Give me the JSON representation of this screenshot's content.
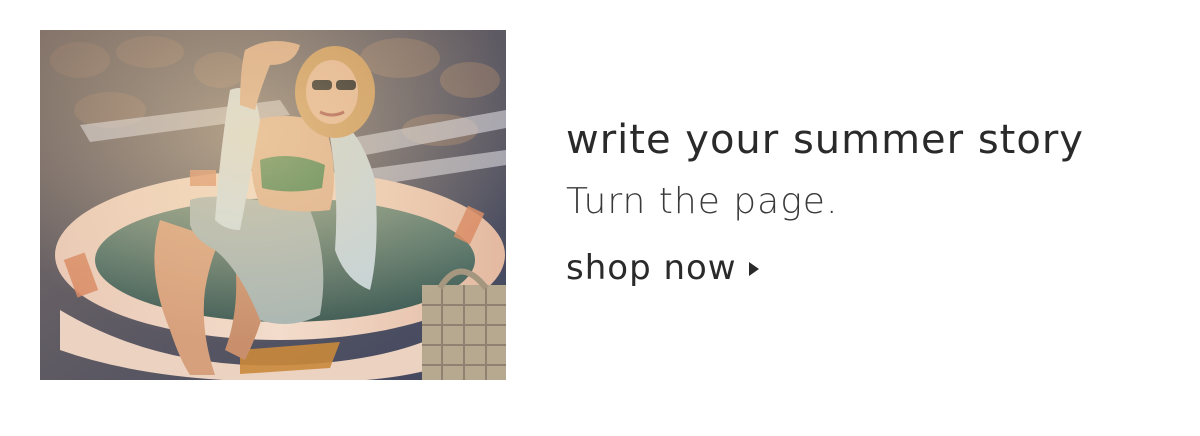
{
  "hero": {
    "image_alt_icon": "photo-woman-in-inflatable-pool"
  },
  "copy": {
    "headline": "write your summer story",
    "subhead": "Turn the page.",
    "cta_label": "shop now"
  },
  "colors": {
    "text": "#2a2a2a",
    "background": "#ffffff"
  }
}
